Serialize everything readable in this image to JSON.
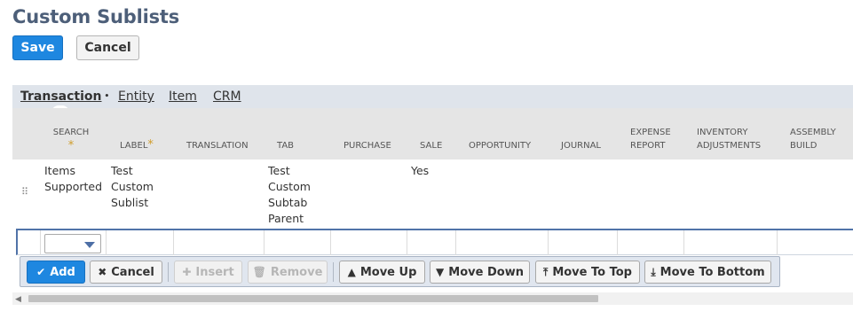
{
  "page": {
    "title": "Custom Sublists"
  },
  "toolbar": {
    "save_label": "Save",
    "cancel_label": "Cancel"
  },
  "tabs": [
    {
      "label": "Transaction",
      "active": true,
      "indicator": "•"
    },
    {
      "label": "Entity"
    },
    {
      "label": "Item"
    },
    {
      "label": "CRM"
    }
  ],
  "grid": {
    "columns": [
      {
        "label": "SEARCH",
        "required": true
      },
      {
        "label": "LABEL",
        "required": true
      },
      {
        "label": "TRANSLATION"
      },
      {
        "label": "TAB"
      },
      {
        "label": "PURCHASE"
      },
      {
        "label": "SALE"
      },
      {
        "label": "OPPORTUNITY"
      },
      {
        "label": "JOURNAL"
      },
      {
        "label": "EXPENSE REPORT"
      },
      {
        "label": "INVENTORY ADJUSTMENTS"
      },
      {
        "label": "ASSEMBLY BUILD"
      }
    ],
    "required_marker": "*",
    "rows": [
      {
        "search": "Items Supported",
        "label": "Test Custom Sublist",
        "translation": "",
        "tab": "Test Custom Subtab Parent",
        "purchase": "",
        "sale": "Yes"
      }
    ],
    "edit_row": {
      "search_value": ""
    }
  },
  "row_actions": {
    "add": "Add",
    "cancel": "Cancel",
    "insert": "Insert",
    "remove": "Remove",
    "move_up": "Move Up",
    "move_down": "Move Down",
    "move_to_top": "Move To Top",
    "move_to_bottom": "Move To Bottom"
  },
  "icons": {
    "add": "check-icon",
    "cancel": "x-icon",
    "insert": "plus-icon",
    "remove": "trash-icon",
    "move_up": "arrow-up-icon",
    "move_down": "arrow-down-icon",
    "move_to_top": "arrow-top-icon",
    "move_to_bottom": "arrow-bottom-icon"
  },
  "colors": {
    "title": "#4d5f79",
    "primary_button": "#1e87e0",
    "tab_bar": "#dfe4eb",
    "header_bg": "#e5e5e5",
    "required": "#d09d2b",
    "edit_row_border": "#5073a8"
  }
}
